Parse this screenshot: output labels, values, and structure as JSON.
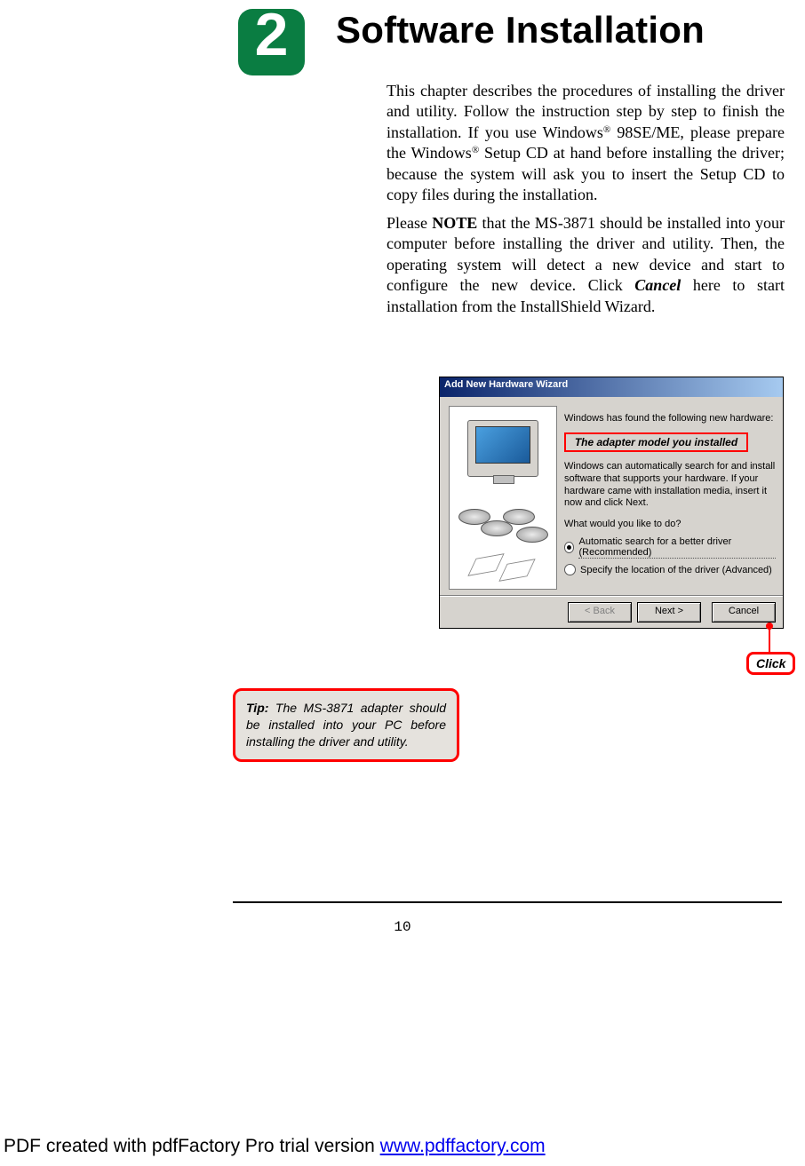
{
  "chapter": {
    "number": "2",
    "title": "Software Installation"
  },
  "paragraphs": {
    "p1_a": "This chapter describes the procedures of installing the driver and utility.  Follow the instruction step by step to finish the installation.  If you use Windows",
    "p1_b": " 98SE/ME, please prepare the Windows",
    "p1_c": " Setup CD at hand before installing the driver; because the system will ask you to insert the Setup CD to copy files during the installation.",
    "p2_a": "Please ",
    "p2_note": "NOTE",
    "p2_b": " that the MS-3871 should be installed into your computer before installing the driver and utility.  Then, the operating system will detect a new device and start to configure the new device.  Click ",
    "p2_cancel": "Cancel",
    "p2_c": " here to start installation from the InstallShield Wizard.",
    "reg": "®"
  },
  "wizard": {
    "title": "Add New Hardware Wizard",
    "found": "Windows has found the following new hardware:",
    "model_callout": "The adapter model you installed",
    "desc": "Windows can automatically search for and install software that supports your hardware. If your hardware came with installation media, insert it now and click Next.",
    "question": "What would you like to do?",
    "opt1": "Automatic search for a better driver (Recommended)",
    "opt2": "Specify the location of the driver (Advanced)",
    "back": "< Back",
    "next": "Next >",
    "cancel": "Cancel"
  },
  "click_label": "Click",
  "tip": {
    "label": "Tip:",
    "text": " The MS-3871 adapter should be installed into your PC before installing the driver and utility."
  },
  "page_number": "10",
  "footer": {
    "prefix": "PDF created with pdfFactory Pro trial version ",
    "link": "www.pdffactory.com"
  }
}
